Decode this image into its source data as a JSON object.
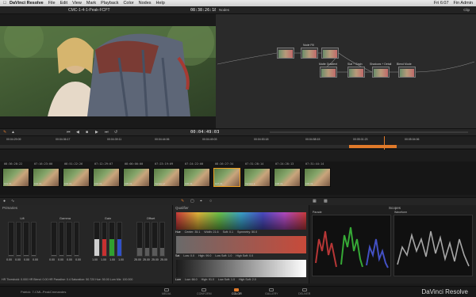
{
  "menubar": {
    "app_name": "DaVinci Resolve",
    "items": [
      "File",
      "Edit",
      "View",
      "Mark",
      "Playback",
      "Color",
      "Nodes",
      "Help"
    ],
    "clock": "Fri 6:07",
    "user": "Fin Admin"
  },
  "viewer": {
    "clip_name": "CMC-1-4-1-Peak-FCPT",
    "timecode": "08:38:26:18"
  },
  "nodes_panel": {
    "title": "Nodes",
    "mode": "Clip",
    "node_labels": [
      "Node Fill",
      "Matte Gradient",
      "Slat + Grain",
      "Shadows + Detail",
      "Blend Mode"
    ]
  },
  "transport": {
    "timecode": "00:04:49:03"
  },
  "ruler": {
    "ticks": [
      "00:04:29:09",
      "00:04:36:17",
      "00:04:39:11",
      "00:04:44:06",
      "00:04:49:03",
      "00:04:53:18",
      "00:04:58:15",
      "00:05:01:23",
      "00:05:04:06"
    ]
  },
  "clips": [
    {
      "num": "10",
      "tc": "08:36:28:22",
      "label": "101 V1"
    },
    {
      "num": "",
      "tc": "07:16:23:00",
      "label": "102 V1"
    },
    {
      "num": "",
      "tc": "08:51:22:26",
      "label": "103 V1"
    },
    {
      "num": "",
      "tc": "07:12:29:07",
      "label": "104 V1"
    },
    {
      "num": "",
      "tc": "08:00:00:00",
      "label": "105 V1"
    },
    {
      "num": "",
      "tc": "07:23:19:09",
      "label": "Version 2"
    },
    {
      "num": "",
      "tc": "07:24:22:00",
      "label": "106 V1"
    },
    {
      "num": "",
      "tc": "08:26:27:34",
      "label": "107 V1"
    },
    {
      "num": "",
      "tc": "07:31:28:14",
      "label": "Version 1"
    },
    {
      "num": "",
      "tc": "07:24:28:13",
      "label": "108 V1"
    },
    {
      "num": "",
      "tc": "07:31:44:14",
      "label": "109 V1"
    }
  ],
  "primaries": {
    "title": "Primaries",
    "wheels": [
      {
        "name": "Lift",
        "values": [
          "0.00",
          "0.00",
          "0.00",
          "0.00"
        ]
      },
      {
        "name": "Gamma",
        "values": [
          "0.00",
          "0.00",
          "0.00",
          "0.00"
        ]
      },
      {
        "name": "Gain",
        "values": [
          "1.00",
          "1.00",
          "1.00",
          "1.00"
        ]
      },
      {
        "name": "Offset",
        "values": [
          "25.00",
          "25.00",
          "25.00",
          "25.00"
        ]
      }
    ],
    "bottom_row": "HR Threshold: 0.000    HR Blend: 0.00    HR Paradise: 0.4    Saturation: 50.720    Hue: 50.00    Lum Mix: 100.000"
  },
  "qualifier": {
    "title": "Qualifier",
    "rows": [
      {
        "name": "Hue",
        "fields": [
          "Center: 35.1",
          "Width: 21.6",
          "Soft: 0.1",
          "Symmetry: 50.0"
        ]
      },
      {
        "name": "Sat",
        "fields": [
          "Low: 0.0",
          "High: 99.0",
          "Low Soft: 1.0",
          "High Soft: 0.0"
        ]
      },
      {
        "name": "Lum",
        "fields": [
          "Low: 66.0",
          "High: 91.0",
          "Low Soft: 1.0",
          "High Soft: 2.0"
        ]
      }
    ]
  },
  "scopes": {
    "title": "Scopes",
    "parade_label": "Parade",
    "waveform_label": "Waveform",
    "scale": [
      "1023",
      "896",
      "768",
      "640",
      "512",
      "384",
      "256",
      "128",
      "0"
    ]
  },
  "bottom": {
    "project": "Patrick: 7-CML-PeakCmmandes",
    "tabs": [
      "MEDIA",
      "CONFORM",
      "COLOR",
      "GALLERY",
      "DELIVER"
    ],
    "active_tab": "COLOR",
    "brand": "DaVinci Resolve"
  },
  "colors": {
    "accent": "#e07a2a",
    "selection": "#f0a020"
  }
}
